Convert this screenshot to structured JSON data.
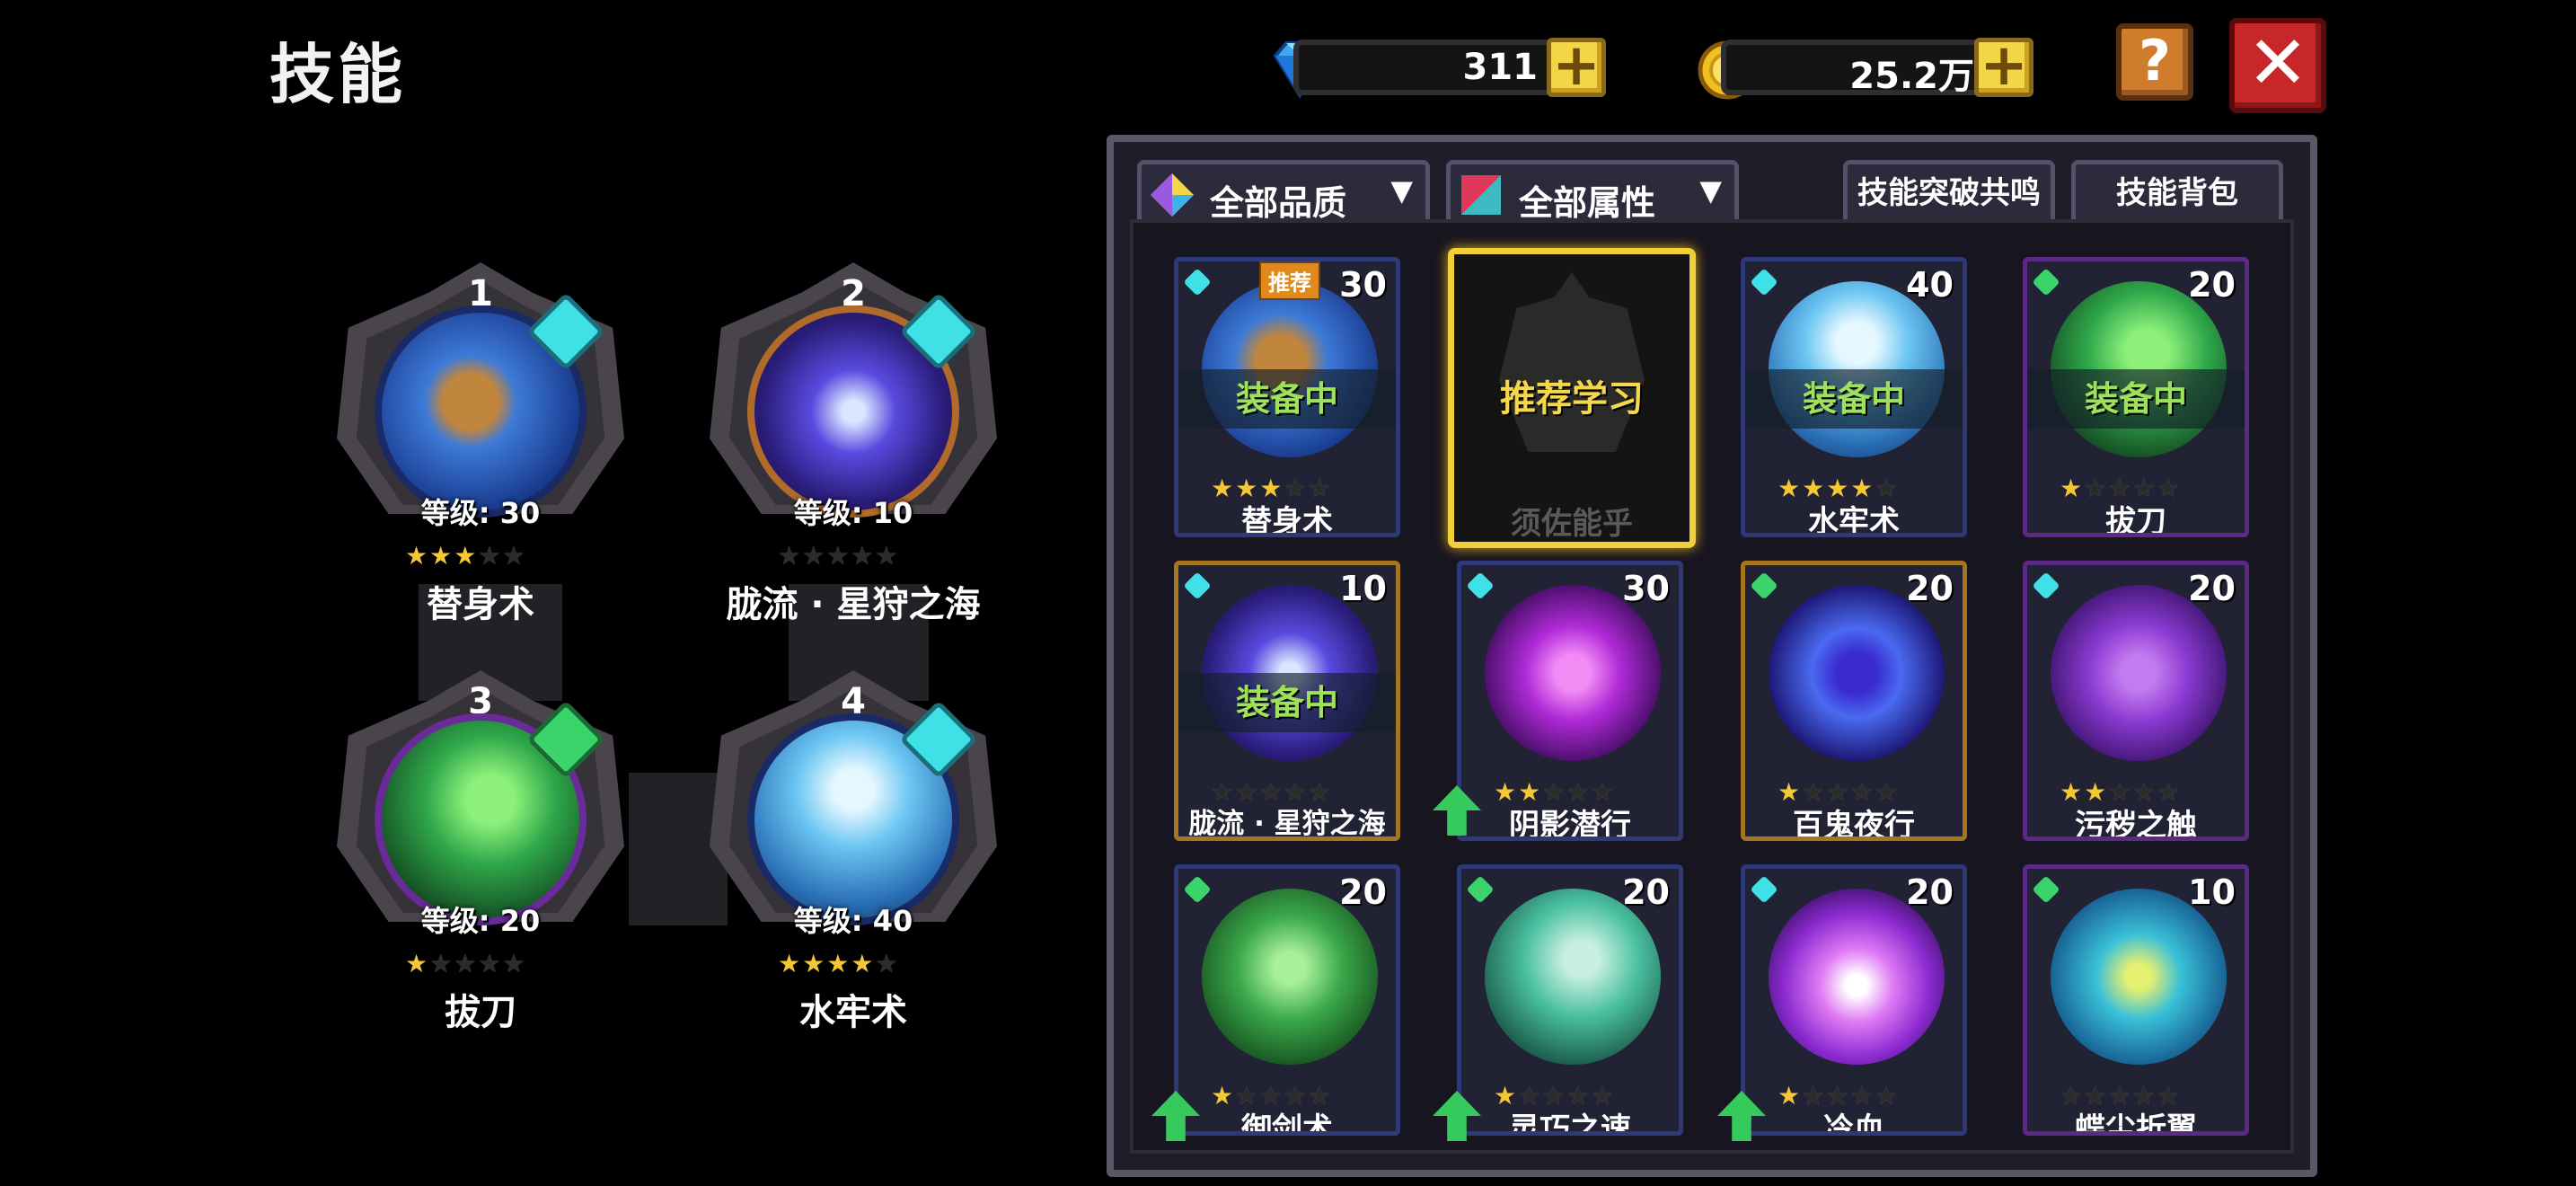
{
  "page_title": "技能",
  "currency": {
    "diamond": {
      "value": "311",
      "icon": "diamond-icon"
    },
    "gold": {
      "value": "25.2万",
      "icon": "gold-coin-icon"
    }
  },
  "buttons": {
    "help": "?",
    "close": "✕",
    "plus": "+"
  },
  "equipped": [
    {
      "slot": "1",
      "level": "等级: 30",
      "name": "替身术",
      "stars": 3,
      "gem_color": "#3fe0e6"
    },
    {
      "slot": "2",
      "level": "等级: 10",
      "name": "胧流 · 星狩之海",
      "stars": 0,
      "gem_color": "#3fe0e6"
    },
    {
      "slot": "3",
      "level": "等级: 20",
      "name": "拔刀",
      "stars": 1,
      "gem_color": "#3bd46a"
    },
    {
      "slot": "4",
      "level": "等级: 40",
      "name": "水牢术",
      "stars": 4,
      "gem_color": "#3fe0e6"
    }
  ],
  "filters": {
    "quality": "全部品质",
    "attribute": "全部属性",
    "breakthrough": "技能突破共鸣",
    "bag": "技能背包"
  },
  "cards": [
    {
      "name": "替身术",
      "level": "30",
      "stars": 3,
      "status": "装备中",
      "badge": "推荐",
      "gem": "#3fe0e6",
      "border": "#2e3a78"
    },
    {
      "name": "须佐能乎",
      "recommend": "推荐学习"
    },
    {
      "name": "水牢术",
      "level": "40",
      "stars": 4,
      "status": "装备中",
      "gem": "#3fe0e6",
      "border": "#2e3a78"
    },
    {
      "name": "拔刀",
      "level": "20",
      "stars": 1,
      "status": "装备中",
      "gem": "#3bd46a",
      "border": "#5b2a86"
    },
    {
      "name": "胧流 · 星狩之海",
      "level": "10",
      "stars": 0,
      "status": "装备中",
      "gem": "#3fe0e6",
      "border": "#a7751f"
    },
    {
      "name": "阴影潜行",
      "level": "30",
      "stars": 2,
      "gem": "#3fe0e6",
      "border": "#2e3a78",
      "upgrade": true
    },
    {
      "name": "百鬼夜行",
      "level": "20",
      "stars": 1,
      "gem": "#3bd46a",
      "border": "#a7751f"
    },
    {
      "name": "污秽之触",
      "level": "20",
      "stars": 2,
      "gem": "#3fe0e6",
      "border": "#5b2a86"
    },
    {
      "name": "御剑术",
      "level": "20",
      "stars": 1,
      "gem": "#3bd46a",
      "border": "#2e3a78",
      "upgrade": true
    },
    {
      "name": "灵巧之速",
      "level": "20",
      "stars": 1,
      "gem": "#3bd46a",
      "border": "#2e3a78",
      "upgrade": true
    },
    {
      "name": "冷血",
      "level": "20",
      "stars": 1,
      "gem": "#3fe0e6",
      "border": "#2e3a78",
      "upgrade": true
    },
    {
      "name": "蝶尘折翼",
      "level": "10",
      "stars": 0,
      "gem": "#3bd46a",
      "border": "#5b2a86"
    }
  ]
}
